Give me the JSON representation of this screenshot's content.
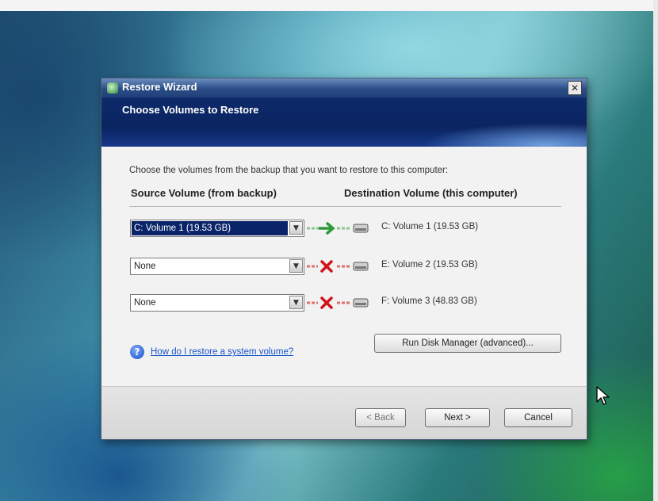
{
  "window": {
    "title": "Restore Wizard",
    "close_glyph": "✕"
  },
  "header": {
    "title": "Choose Volumes to Restore"
  },
  "content": {
    "intro": "Choose the volumes from the backup that you want to restore to this computer:",
    "source_header": "Source Volume (from backup)",
    "destination_header": "Destination Volume (this computer)",
    "rows": [
      {
        "source": "C: Volume 1 (19.53 GB)",
        "status": "restore-arrow-icon",
        "destination": "C: Volume 1 (19.53 GB)"
      },
      {
        "source": "None",
        "status": "no-restore-x-icon",
        "destination": "E: Volume 2 (19.53 GB)"
      },
      {
        "source": "None",
        "status": "no-restore-x-icon",
        "destination": "F: Volume 3 (48.83 GB)"
      }
    ],
    "help_link": "How do I restore a system volume?",
    "disk_manager_button": "Run Disk Manager (advanced)..."
  },
  "footer": {
    "back_button": "< Back",
    "next_button": "Next >",
    "cancel_button": "Cancel"
  },
  "colors": {
    "header_blue": "#0a2460",
    "ok_green": "#2e9a3a",
    "error_red": "#d0121b",
    "link_blue": "#1a55c8"
  }
}
